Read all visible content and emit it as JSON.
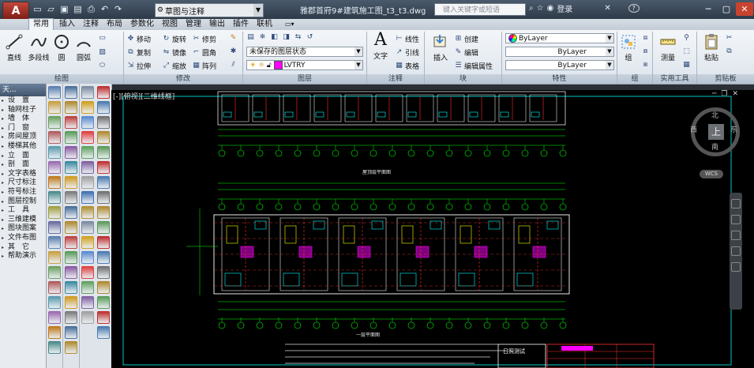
{
  "titlebar": {
    "app_letter": "A",
    "workspace": "草图与注释",
    "document_title": "雅郡首府9#建筑施工图_t3_t3.dwg",
    "search_placeholder": "键入关键字或短语",
    "login": "登录",
    "help": "?"
  },
  "tabs": [
    "常用",
    "插入",
    "注释",
    "布局",
    "参数化",
    "视图",
    "管理",
    "输出",
    "插件",
    "联机"
  ],
  "ribbon": {
    "draw": {
      "label": "绘图",
      "line": "直线",
      "polyline": "多段线",
      "circle": "圆",
      "arc": "圆弧"
    },
    "modify": {
      "label": "修改",
      "move": "移动",
      "rotate": "旋转",
      "trim": "修剪",
      "copy": "复制",
      "mirror": "镜像",
      "fillet": "圆角",
      "stretch": "拉伸",
      "scale": "缩放",
      "array": "阵列"
    },
    "layers": {
      "label": "图层",
      "state": "未保存的图层状态",
      "current": "LVTRY"
    },
    "annotation": {
      "label": "注释",
      "text": "文字",
      "linear": "线性",
      "leader": "引线",
      "table": "表格"
    },
    "block": {
      "label": "块",
      "insert": "插入",
      "create": "创建",
      "edit": "编辑",
      "attributes": "编辑属性"
    },
    "properties": {
      "label": "特性",
      "color": "ByLayer",
      "linetype": "ByLayer",
      "lineweight": "ByLayer"
    },
    "groups": {
      "label": "组",
      "group": "组"
    },
    "utilities": {
      "label": "实用工具",
      "measure": "测量"
    },
    "clipboard": {
      "label": "剪贴板",
      "paste": "粘贴"
    }
  },
  "leftmenu": {
    "header": "天...",
    "items": [
      "设　置",
      "轴网柱子",
      "墙　体",
      "门　窗",
      "房间屋顶",
      "楼梯其他",
      "立　面",
      "剖　面",
      "文字表格",
      "尺寸标注",
      "符号标注",
      "图层控制",
      "工　具",
      "三维建模",
      "图块图案",
      "文件布图",
      "其　它",
      "帮助演示"
    ]
  },
  "viewport": {
    "label": "[-][俯视][二维线框]",
    "viewcube": {
      "north": "北",
      "south": "南",
      "west": "西",
      "east": "东",
      "top": "上"
    },
    "wcs": "WCS",
    "plan_title": "一层平面图",
    "roof_title": "屋顶层平面图",
    "stamp": "日照测试"
  },
  "colors": {
    "accent": "#c4473a",
    "cad_bg": "#000000",
    "layer_magenta": "#ff00ff"
  }
}
